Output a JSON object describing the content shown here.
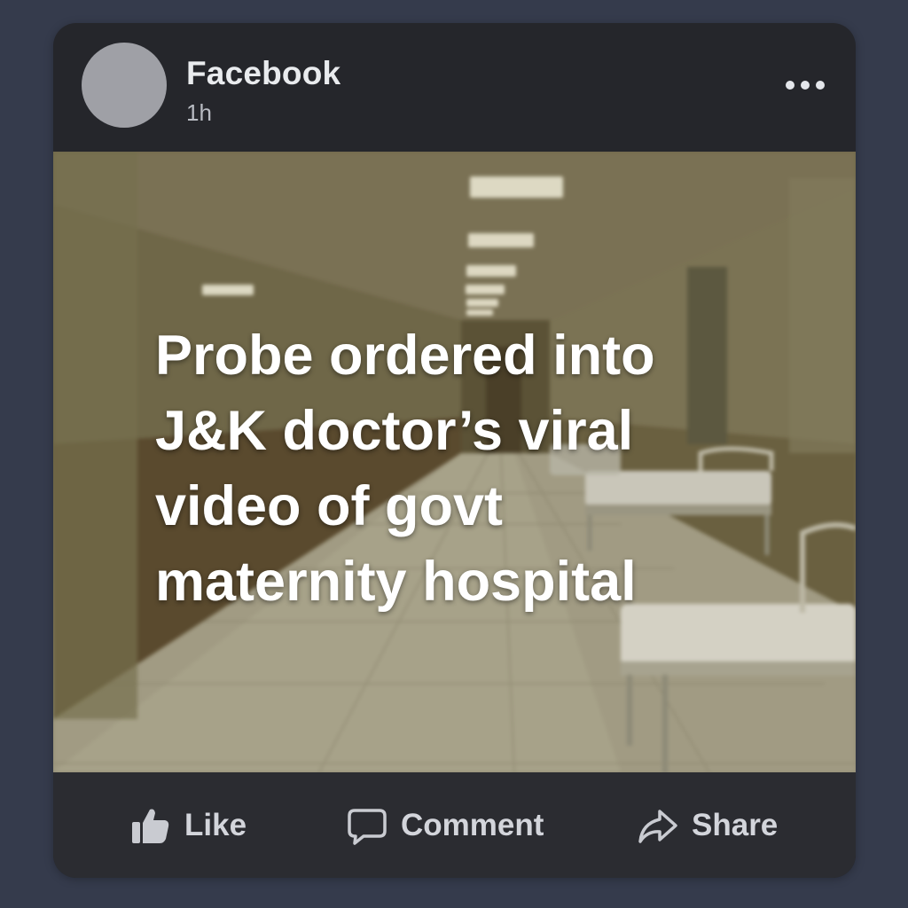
{
  "post": {
    "author": "Facebook",
    "time": "1h",
    "headline": "Probe ordered into J&K doctor’s viral video of govt maternity hospital"
  },
  "actions": {
    "like_label": "Like",
    "comment_label": "Comment",
    "share_label": "Share"
  },
  "icons": {
    "like": "thumbs-up-icon",
    "comment": "speech-bubble-icon",
    "share": "share-arrow-icon",
    "more": "more-dots-icon"
  },
  "colors": {
    "background": "#353b4c",
    "card": "#25262b",
    "action_bar": "#2b2c31",
    "text_primary": "#e9ebee",
    "text_secondary": "#b8bbc2"
  }
}
